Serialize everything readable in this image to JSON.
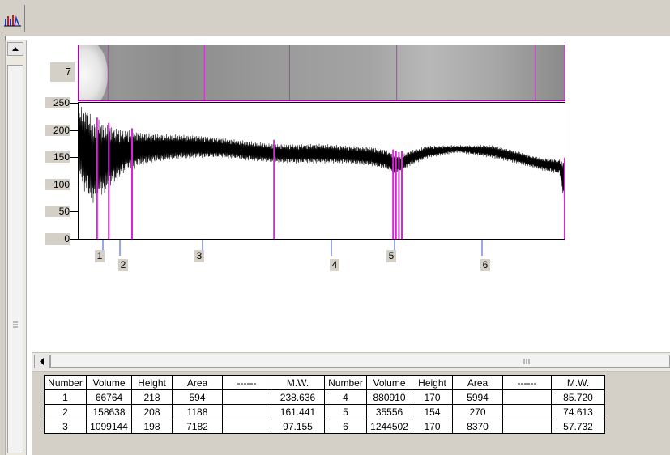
{
  "toolbar": {
    "tool_icon": "histogram-icon"
  },
  "gel": {
    "lane_label": "7"
  },
  "profile": {
    "y_ticks": [
      "250",
      "200",
      "150",
      "100",
      "50",
      "0"
    ],
    "y_range": [
      0,
      250
    ],
    "x_range": [
      0,
      100
    ],
    "lane_markers_x": [
      3.8,
      6.2,
      11.0,
      40.2,
      64.7,
      65.3,
      65.9,
      66.5,
      100
    ],
    "bands": [
      {
        "label": "1",
        "x": 5.0
      },
      {
        "label": "2",
        "x": 8.5
      },
      {
        "label": "3",
        "x": 25.5
      },
      {
        "label": "4",
        "x": 52.0
      },
      {
        "label": "5",
        "x": 65.0
      },
      {
        "label": "6",
        "x": 83.0
      }
    ],
    "upper_envelope": [
      [
        0,
        238
      ],
      [
        1,
        236
      ],
      [
        2,
        232
      ],
      [
        3,
        210
      ],
      [
        4,
        215
      ],
      [
        5,
        208
      ],
      [
        6,
        205
      ],
      [
        8,
        198
      ],
      [
        10,
        195
      ],
      [
        15,
        192
      ],
      [
        20,
        190
      ],
      [
        25,
        188
      ],
      [
        30,
        183
      ],
      [
        35,
        178
      ],
      [
        40,
        173
      ],
      [
        45,
        172
      ],
      [
        50,
        173
      ],
      [
        55,
        170
      ],
      [
        60,
        168
      ],
      [
        63,
        163
      ],
      [
        65,
        154
      ],
      [
        66,
        150
      ],
      [
        68,
        160
      ],
      [
        72,
        170
      ],
      [
        78,
        171
      ],
      [
        85,
        171
      ],
      [
        90,
        160
      ],
      [
        95,
        148
      ],
      [
        99,
        145
      ],
      [
        100,
        140
      ]
    ],
    "lower_envelope": [
      [
        0,
        130
      ],
      [
        1,
        95
      ],
      [
        2,
        80
      ],
      [
        3,
        70
      ],
      [
        4,
        80
      ],
      [
        5,
        85
      ],
      [
        6,
        95
      ],
      [
        8,
        110
      ],
      [
        10,
        130
      ],
      [
        15,
        142
      ],
      [
        20,
        148
      ],
      [
        25,
        150
      ],
      [
        30,
        150
      ],
      [
        35,
        145
      ],
      [
        40,
        142
      ],
      [
        45,
        140
      ],
      [
        50,
        140
      ],
      [
        55,
        140
      ],
      [
        60,
        136
      ],
      [
        63,
        130
      ],
      [
        65,
        120
      ],
      [
        66,
        122
      ],
      [
        68,
        135
      ],
      [
        72,
        150
      ],
      [
        78,
        160
      ],
      [
        85,
        150
      ],
      [
        90,
        140
      ],
      [
        95,
        128
      ],
      [
        99,
        120
      ],
      [
        100,
        60
      ]
    ]
  },
  "table": {
    "headers": [
      "Number",
      "Volume",
      "Height",
      "Area",
      "------",
      "M.W.",
      "Number",
      "Volume",
      "Height",
      "Area",
      "------",
      "M.W."
    ],
    "rows": [
      [
        "1",
        "66764",
        "218",
        "594",
        "",
        "238.636",
        "4",
        "880910",
        "170",
        "5994",
        "",
        "85.720"
      ],
      [
        "2",
        "158638",
        "208",
        "1188",
        "",
        "161.441",
        "5",
        "35556",
        "154",
        "270",
        "",
        "74.613"
      ],
      [
        "3",
        "1099144",
        "198",
        "7182",
        "",
        "97.155",
        "6",
        "1244502",
        "170",
        "8370",
        "",
        "57.732"
      ]
    ]
  },
  "colors": {
    "lane_line": "#e020e0",
    "band_tick": "#3050d0",
    "trace": "#000000",
    "panel_bg": "#d4d0c8"
  }
}
